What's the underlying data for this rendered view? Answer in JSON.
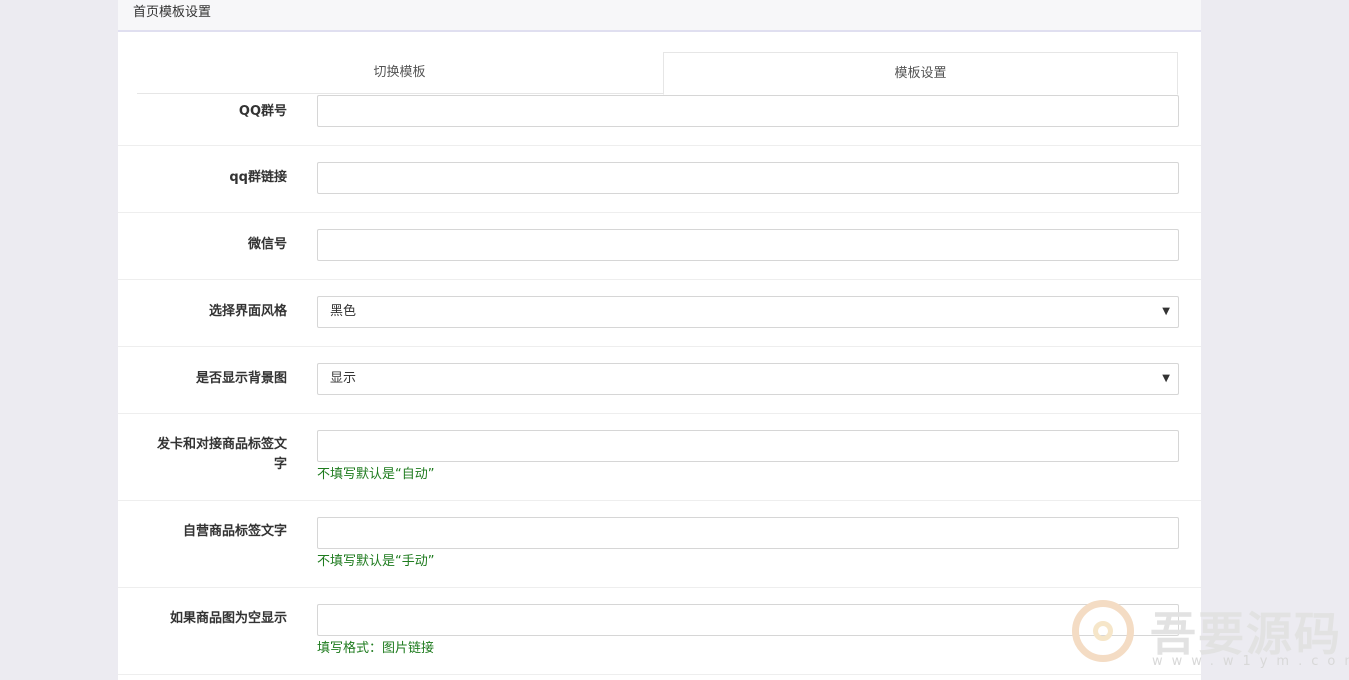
{
  "panel": {
    "title": "首页模板设置"
  },
  "tabs": [
    {
      "label": "切换模板",
      "active": false
    },
    {
      "label": "模板设置",
      "active": true
    }
  ],
  "form": {
    "qq_group": {
      "label": "QQ群号",
      "value": ""
    },
    "qq_group_link": {
      "label": "qq群链接",
      "value": ""
    },
    "wechat": {
      "label": "微信号",
      "value": ""
    },
    "ui_style": {
      "label": "选择界面风格",
      "value": "黑色"
    },
    "show_bg": {
      "label": "是否显示背景图",
      "value": "显示"
    },
    "card_tag": {
      "label_line1": "发卡和对接商品标签文",
      "label_line2": "字",
      "value": "",
      "help": "不填写默认是“自动”"
    },
    "self_tag": {
      "label": "自营商品标签文字",
      "value": "",
      "help": "不填写默认是“手动”"
    },
    "empty_img": {
      "label": "如果商品图为空显示",
      "value": "",
      "help": "填写格式：图片链接"
    }
  },
  "watermark": {
    "text": "吾要源码",
    "url": "www.w1ym.com"
  },
  "colors": {
    "help_text": "#1e7b1e",
    "background": "#ecebf1",
    "panel": "#ffffff"
  }
}
